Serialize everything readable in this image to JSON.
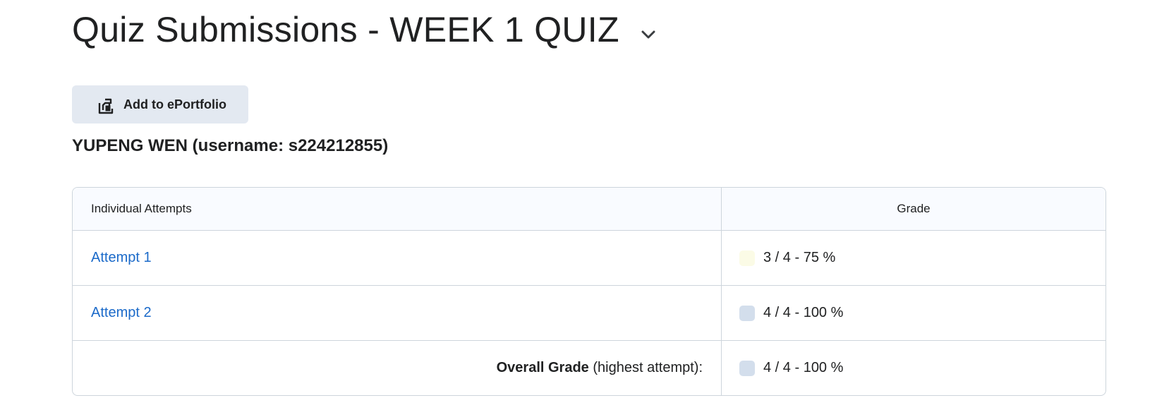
{
  "page": {
    "title": "Quiz Submissions - WEEK 1 QUIZ"
  },
  "toolbar": {
    "eportfolio_label": "Add to ePortfolio",
    "eportfolio_icon": "eportfolio-icon"
  },
  "user": {
    "heading": "YUPENG WEN (username: s224212855)"
  },
  "table": {
    "headers": {
      "attempts": "Individual Attempts",
      "grade": "Grade"
    },
    "rows": [
      {
        "attempt": "Attempt 1",
        "grade": "3 / 4 - 75 %",
        "swatch_color": "#fbfbe6"
      },
      {
        "attempt": "Attempt 2",
        "grade": "4 / 4 - 100 %",
        "swatch_color": "#d3deec"
      }
    ],
    "overall": {
      "label_bold": "Overall Grade",
      "label_rest": "(highest attempt):",
      "grade": "4 / 4 - 100 %",
      "swatch_color": "#d3deec"
    }
  },
  "colors": {
    "link": "#1b6ac9",
    "button_bg": "#e3e9f1",
    "border": "#cdd5dc",
    "header_bg": "#f9fbff"
  }
}
